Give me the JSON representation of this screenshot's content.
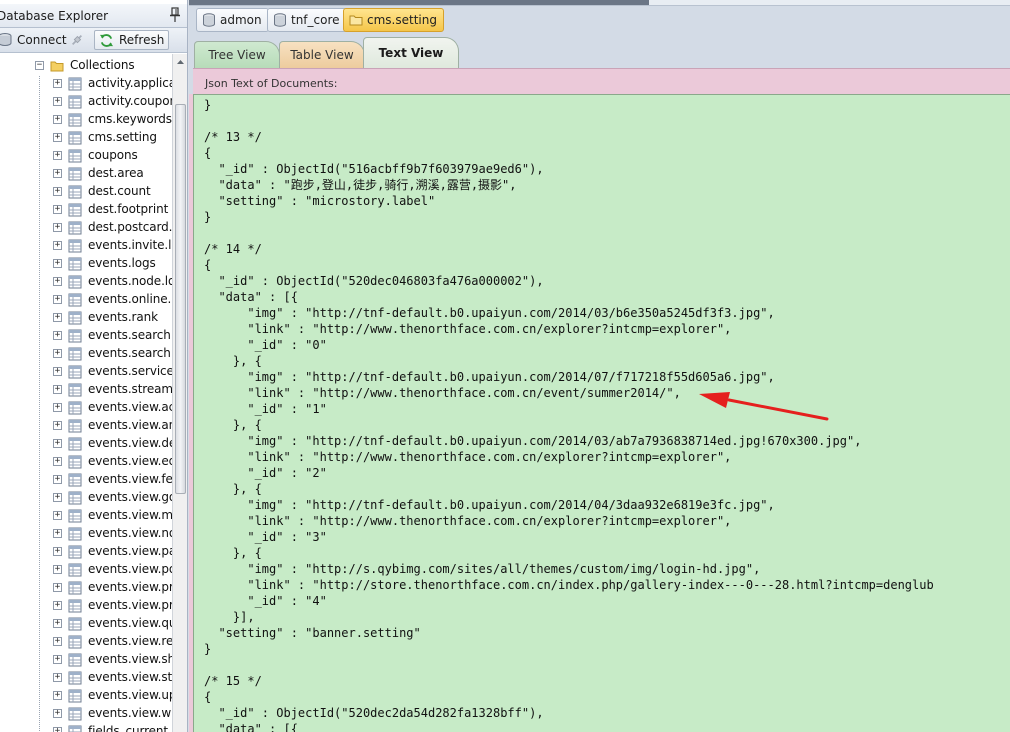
{
  "explorer": {
    "title": "Database Explorer",
    "connect_label": "Connect",
    "refresh_label": "Refresh",
    "collections_label": "Collections",
    "items": [
      "activity.applicat",
      "activity.coupon",
      "cms.keywords",
      "cms.setting",
      "coupons",
      "dest.area",
      "dest.count",
      "dest.footprint",
      "dest.postcard.c",
      "events.invite.log",
      "events.logs",
      "events.node.log",
      "events.online.lo",
      "events.rank",
      "events.search.a",
      "events.search.lo",
      "events.service.lo",
      "events.stream",
      "events.view.act",
      "events.view.ans",
      "events.view.des",
      "events.view.equ",
      "events.view.fee",
      "events.view.goo",
      "events.view.mic",
      "events.view.not",
      "events.view.par",
      "events.view.pos",
      "events.view.pro",
      "events.view.pro",
      "events.view.que",
      "events.view.rep",
      "events.view.shu",
      "events.view.sto",
      "events.view.ups",
      "events.view.wik",
      "fields_current_c"
    ]
  },
  "doc_tabs": [
    {
      "label": "admon",
      "icon": "database-icon"
    },
    {
      "label": "tnf_core",
      "icon": "database-icon"
    },
    {
      "label": "cms.setting",
      "icon": "folder-icon",
      "active": true
    }
  ],
  "view_tabs": {
    "tree": "Tree View",
    "table": "Table View",
    "text": "Text View"
  },
  "json_header": "Json Text of Documents:",
  "json_lines": [
    "}",
    "",
    "/* 13 */",
    "{",
    "  \"_id\" : ObjectId(\"516acbff9b7f603979ae9ed6\"),",
    "  \"data\" : \"跑步,登山,徒步,骑行,溯溪,露营,摄影\",",
    "  \"setting\" : \"microstory.label\"",
    "}",
    "",
    "/* 14 */",
    "{",
    "  \"_id\" : ObjectId(\"520dec046803fa476a000002\"),",
    "  \"data\" : [{",
    "      \"img\" : \"http://tnf-default.b0.upaiyun.com/2014/03/b6e350a5245df3f3.jpg\",",
    "      \"link\" : \"http://www.thenorthface.com.cn/explorer?intcmp=explorer\",",
    "      \"_id\" : \"0\"",
    "    }, {",
    "      \"img\" : \"http://tnf-default.b0.upaiyun.com/2014/07/f717218f55d605a6.jpg\",",
    "      \"link\" : \"http://www.thenorthface.com.cn/event/summer2014/\",",
    "      \"_id\" : \"1\"",
    "    }, {",
    "      \"img\" : \"http://tnf-default.b0.upaiyun.com/2014/03/ab7a7936838714ed.jpg!670x300.jpg\",",
    "      \"link\" : \"http://www.thenorthface.com.cn/explorer?intcmp=explorer\",",
    "      \"_id\" : \"2\"",
    "    }, {",
    "      \"img\" : \"http://tnf-default.b0.upaiyun.com/2014/04/3daa932e6819e3fc.jpg\",",
    "      \"link\" : \"http://www.thenorthface.com.cn/explorer?intcmp=explorer\",",
    "      \"_id\" : \"3\"",
    "    }, {",
    "      \"img\" : \"http://s.qybimg.com/sites/all/themes/custom/img/login-hd.jpg\",",
    "      \"link\" : \"http://store.thenorthface.com.cn/index.php/gallery-index---0---28.html?intcmp=denglub",
    "      \"_id\" : \"4\"",
    "    }],",
    "  \"setting\" : \"banner.setting\"",
    "}",
    "",
    "/* 15 */",
    "{",
    "  \"_id\" : ObjectId(\"520dec2da54d282fa1328bff\"),",
    "  \"data\" : [{"
  ],
  "colors": {
    "json_bg": "#c7ebc7",
    "header_bg": "#ebc9d9",
    "active_tab": "#f5c64a",
    "arrow": "#e5201e"
  }
}
